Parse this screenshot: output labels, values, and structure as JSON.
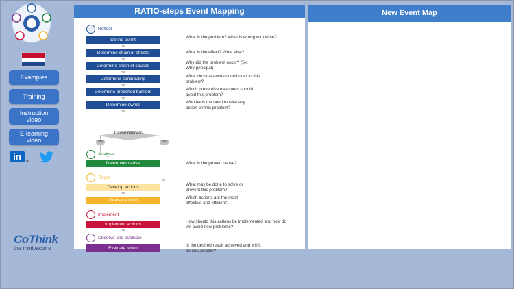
{
  "sidebar": {
    "buttons": [
      "Examples",
      "Training",
      "Instruction video",
      "E-learning video"
    ],
    "flag_colors": [
      "#c8102e",
      "#ffffff",
      "#21468b"
    ],
    "linkedin_text": "in",
    "linkedin_tm": "TM"
  },
  "brand": {
    "name": "CoThink",
    "tagline": "the motivactors"
  },
  "left_panel": {
    "title": "RATIO-steps Event Mapping",
    "sections": {
      "reflect": "Reflect",
      "analyse": "Analyse",
      "target": "Target",
      "implement": "Implement",
      "observe": "Observe and evaluate"
    },
    "steps": [
      {
        "label": "Define event",
        "question": "What is the problem? What is wrong with what?"
      },
      {
        "label": "Determine chain of effects",
        "question": "What is the effect? What else?"
      },
      {
        "label": "Determine chain of causes",
        "question": "Why did the problem occur? (5x Why-principal)"
      },
      {
        "label": "Determine contributing circumstances",
        "question": "What circumstances contributed to this problem?"
      },
      {
        "label": "Determine breached barriers",
        "question": "Which preventive measures should avoid this problem?"
      },
      {
        "label": "Determine owner",
        "question": "Who feels the need to take any action on this problem?"
      },
      {
        "label": "Determine cause",
        "question": "What is the proven cause?"
      },
      {
        "label": "Develop actions",
        "question": "What may be done to solve or prevent this problem?"
      },
      {
        "label": "Choose actions",
        "question": "Which actions are the most effective and efficient?"
      },
      {
        "label": "Implement actions",
        "question": "How should this actions be implemented and how do we avoid new problems?"
      },
      {
        "label": "Evaluate result",
        "question": "Is the desired result achieved and will it be sustainable?"
      }
    ],
    "decision": {
      "label": "Cause needed?",
      "yes": "Yes",
      "no": "No"
    }
  },
  "right_panel": {
    "title": "New Event Map"
  },
  "colors": {
    "reflect": "#1f4e96",
    "analyse": "#1f8a3c",
    "target": "#f6b52a",
    "implement": "#c8143c",
    "observe": "#7b2f8e",
    "header": "#3f7ecb",
    "background": "#a6b8d8"
  }
}
